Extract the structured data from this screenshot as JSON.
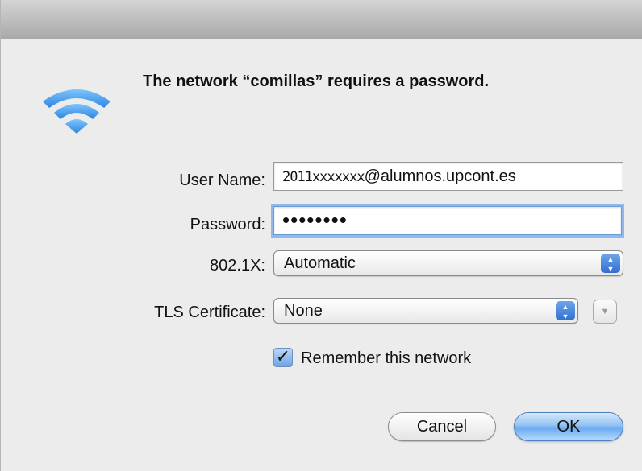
{
  "dialog": {
    "headline": "The network “comillas” requires a password.",
    "icon": "wifi-icon",
    "accent_color": "#3d9be9"
  },
  "form": {
    "username_label": "User Name:",
    "username_prefix": "2011xxxxxxx",
    "username_suffix": "@alumnos.upcont.es",
    "password_label": "Password:",
    "password_value": "••••••••",
    "eap_label": "802.1X:",
    "eap_value": "Automatic",
    "tls_label": "TLS Certificate:",
    "tls_value": "None",
    "remember_label": "Remember this network",
    "remember_checked": true
  },
  "buttons": {
    "cancel_label": "Cancel",
    "ok_label": "OK"
  }
}
